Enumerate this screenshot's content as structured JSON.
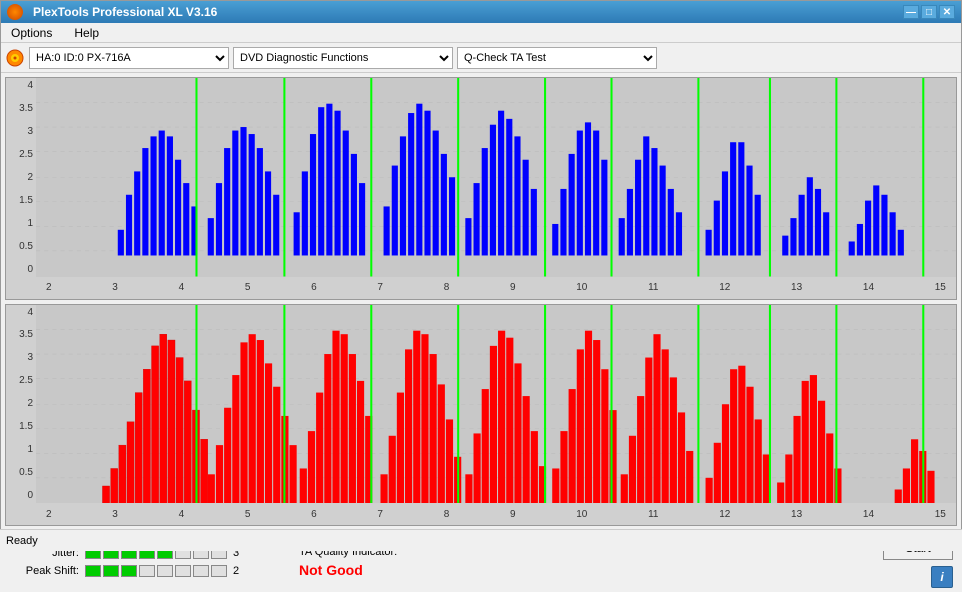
{
  "titleBar": {
    "title": "PlexTools Professional XL V3.16",
    "minimizeLabel": "—",
    "maximizeLabel": "□",
    "closeLabel": "✕"
  },
  "menuBar": {
    "items": [
      "Options",
      "Help"
    ]
  },
  "toolbar": {
    "deviceOptions": [
      "HA:0 ID:0  PX-716A"
    ],
    "functionOptions": [
      "DVD Diagnostic Functions"
    ],
    "testOptions": [
      "Q-Check TA Test"
    ]
  },
  "charts": {
    "topChart": {
      "yLabels": [
        "4",
        "3.5",
        "3",
        "2.5",
        "2",
        "1.5",
        "1",
        "0.5",
        "0"
      ],
      "xLabels": [
        "2",
        "3",
        "4",
        "5",
        "6",
        "7",
        "8",
        "9",
        "10",
        "11",
        "12",
        "13",
        "14",
        "15"
      ],
      "color": "blue"
    },
    "bottomChart": {
      "yLabels": [
        "4",
        "3.5",
        "3",
        "2.5",
        "2",
        "1.5",
        "1",
        "0.5",
        "0"
      ],
      "xLabels": [
        "2",
        "3",
        "4",
        "5",
        "6",
        "7",
        "8",
        "9",
        "10",
        "11",
        "12",
        "13",
        "14",
        "15"
      ],
      "color": "red"
    }
  },
  "metrics": {
    "jitter": {
      "label": "Jitter:",
      "filledCells": 5,
      "totalCells": 8,
      "value": "3"
    },
    "peakShift": {
      "label": "Peak Shift:",
      "filledCells": 3,
      "totalCells": 8,
      "value": "2"
    },
    "taQuality": {
      "label": "TA Quality Indicator:",
      "value": "Not Good"
    }
  },
  "buttons": {
    "start": "Start",
    "info": "i"
  },
  "statusBar": {
    "text": "Ready"
  }
}
